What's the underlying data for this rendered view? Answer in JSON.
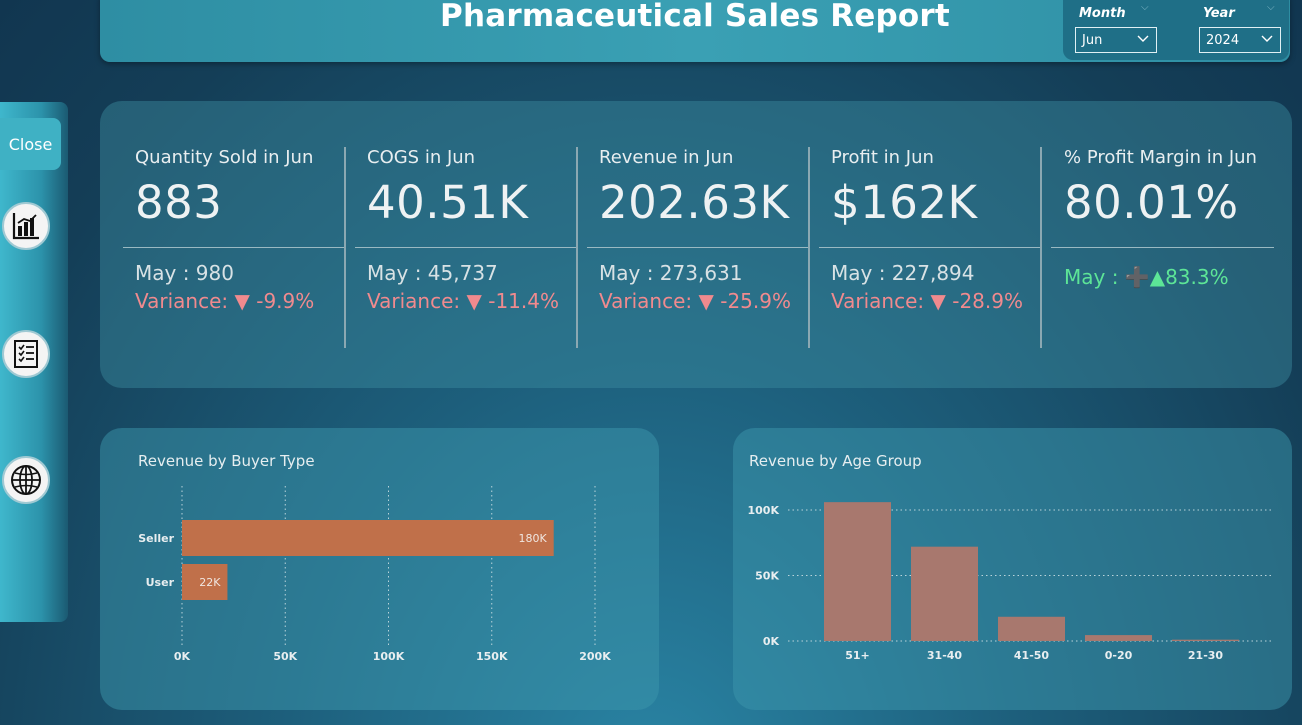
{
  "header": {
    "title": "Pharmaceutical Sales Report"
  },
  "filters": {
    "month": {
      "label": "Month",
      "value": "Jun"
    },
    "year": {
      "label": "Year",
      "value": "2024"
    }
  },
  "sidebar": {
    "close_label": "Close",
    "icons": [
      "bar-chart-icon",
      "checklist-icon",
      "globe-icon"
    ]
  },
  "kpis": [
    {
      "label": "Quantity Sold in Jun",
      "value": "883",
      "prev": "May : 980",
      "variance": "Variance: ▼ -9.9%"
    },
    {
      "label": "COGS in Jun",
      "value": "40.51K",
      "prev": "May : 45,737",
      "variance": "Variance: ▼ -11.4%"
    },
    {
      "label": "Revenue in Jun",
      "value": "202.63K",
      "prev": "May : 273,631",
      "variance": "Variance: ▼ -25.9%"
    },
    {
      "label": "Profit in Jun",
      "value": "$162K",
      "prev": "May : 227,894",
      "variance": "Variance: ▼ -28.9%"
    },
    {
      "label": "% Profit Margin in Jun",
      "value": "80.01%",
      "prev_variance": "May : ➕▲83.3%"
    }
  ],
  "colors": {
    "negative": "#f08a8e",
    "positive": "#5de597",
    "buyer_bar": "#c0704a",
    "age_bar": "#a8786e"
  },
  "chart_data": [
    {
      "type": "bar",
      "orientation": "horizontal",
      "title": "Revenue by Buyer Type",
      "categories": [
        "Seller",
        "User"
      ],
      "values": [
        180000,
        22000
      ],
      "data_labels": [
        "180K",
        "22K"
      ],
      "xlim": [
        0,
        200000
      ],
      "x_ticks": [
        "0K",
        "50K",
        "100K",
        "150K",
        "200K"
      ],
      "grid": true
    },
    {
      "type": "bar",
      "orientation": "vertical",
      "title": "Revenue by Age Group",
      "categories": [
        "51+",
        "31-40",
        "41-50",
        "0-20",
        "21-30"
      ],
      "values": [
        106000,
        72000,
        18500,
        4500,
        1000
      ],
      "ylim": [
        0,
        100000
      ],
      "y_ticks": [
        "0K",
        "50K",
        "100K"
      ],
      "grid": true
    }
  ]
}
